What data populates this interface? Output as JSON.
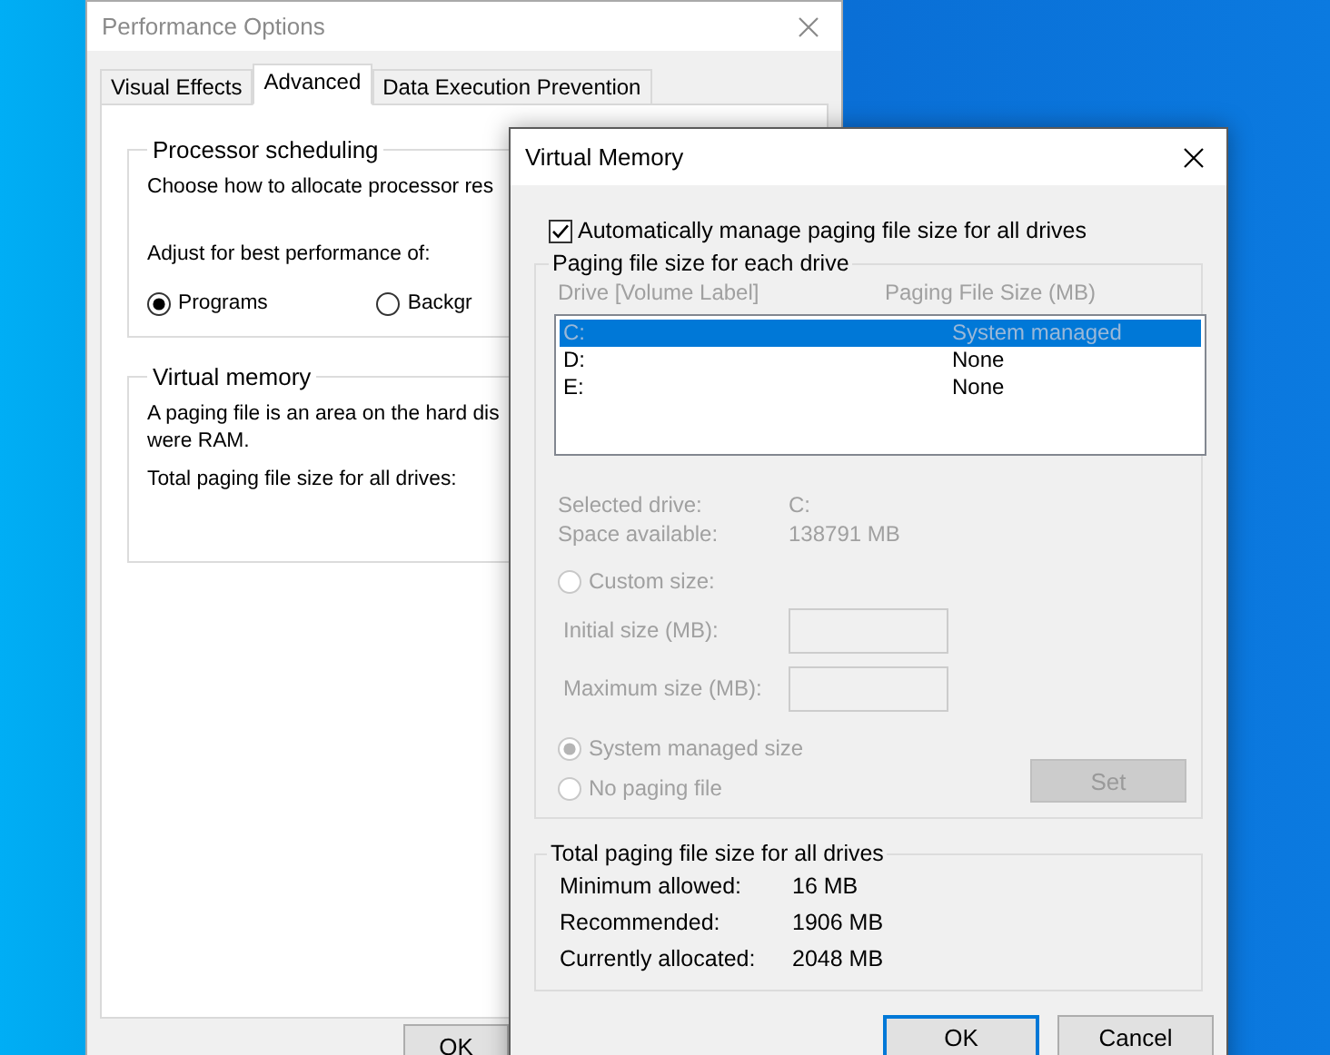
{
  "performance_options": {
    "title": "Performance Options",
    "active": false,
    "tabs": [
      {
        "label": "Visual Effects",
        "selected": false
      },
      {
        "label": "Advanced",
        "selected": true
      },
      {
        "label": "Data Execution Prevention",
        "selected": false
      }
    ],
    "processor_scheduling": {
      "title": "Processor scheduling",
      "description": "Choose how to allocate processor res",
      "adjust_label": "Adjust for best performance of:",
      "options": [
        {
          "label": "Programs",
          "selected": true
        },
        {
          "label": "Backgr",
          "selected": false
        }
      ]
    },
    "virtual_memory": {
      "title": "Virtual memory",
      "description_lines": [
        "A paging file is an area on the hard dis",
        "were RAM."
      ],
      "total_label": "Total paging file size for all drives:"
    },
    "buttons": [
      "OK"
    ]
  },
  "virtual_memory_dialog": {
    "title": "Virtual Memory",
    "active": true,
    "auto_manage": {
      "label": "Automatically manage paging file size for all drives",
      "checked": true
    },
    "drives_group": {
      "title": "Paging file size for each drive",
      "disabled": true,
      "columns": [
        "Drive  [Volume Label]",
        "Paging File Size (MB)"
      ],
      "drives": [
        {
          "drive": "C:",
          "size": "System managed",
          "selected": true
        },
        {
          "drive": "D:",
          "size": "None",
          "selected": false
        },
        {
          "drive": "E:",
          "size": "None",
          "selected": false
        }
      ],
      "info": [
        {
          "label": "Selected drive:",
          "value": "C:"
        },
        {
          "label": "Space available:",
          "value": "138791 MB"
        }
      ],
      "size_settings": [
        {
          "kind": "radio",
          "label": "Custom size:",
          "selected": false
        },
        {
          "kind": "field",
          "label": "Initial size (MB):"
        },
        {
          "kind": "field",
          "label": "Maximum size (MB):"
        },
        {
          "kind": "radio",
          "label": "System managed size",
          "selected": true
        },
        {
          "kind": "radio",
          "label": "No paging file",
          "selected": false
        }
      ],
      "set_button": "Set"
    },
    "totals": {
      "title": "Total paging file size for all drives",
      "rows": [
        {
          "label": "Minimum allowed:",
          "value": "16 MB"
        },
        {
          "label": "Recommended:",
          "value": "1906 MB"
        },
        {
          "label": "Currently allocated:",
          "value": "2048 MB"
        }
      ]
    },
    "buttons": [
      {
        "label": "OK",
        "default": true
      },
      {
        "label": "Cancel",
        "default": false
      }
    ]
  }
}
